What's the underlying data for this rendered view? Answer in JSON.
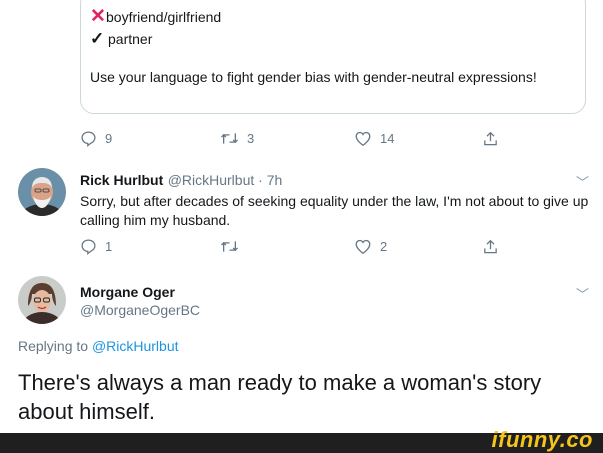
{
  "quoted_card": {
    "cross_item": "boyfriend/girlfriend",
    "check_item": "partner",
    "text": "Use your language to fight gender bias with gender-neutral expressions!"
  },
  "tweet1_actions": {
    "replies": "9",
    "retweets": "3",
    "likes": "14"
  },
  "reply1": {
    "name": "Rick Hurlbut",
    "handle_time": "@RickHurlbut · 7h",
    "text": "Sorry, but after decades of seeking equality under the law, I'm not about to give up calling him my husband.",
    "replies": "1",
    "retweets": "",
    "likes": "2"
  },
  "reply2": {
    "name": "Morgane Oger",
    "handle": "@MorganeOgerBC",
    "replying_prefix": "Replying to",
    "replying_to": "@RickHurlbut",
    "text": "There's always a man ready to make a woman's story about himself."
  },
  "watermark": "ifunny.co",
  "colors": {
    "accent": "#1b95e0",
    "cross": "#e0245e",
    "muted": "#657786",
    "border": "#ccd6dd",
    "footer": "#1f1f1f",
    "watermark": "#f6c51b"
  }
}
